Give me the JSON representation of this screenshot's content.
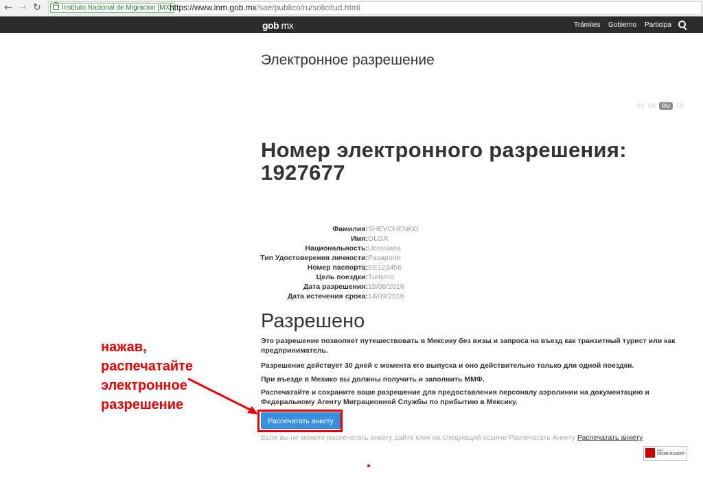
{
  "browser": {
    "ev_label": "Instituto Nacional de Migracion [MX]",
    "url_host": "https://www.inm.gob.mx",
    "url_path": "/sae/publico/ru/solicitud.html",
    "back_icon": "back-arrow-icon",
    "forward_icon": "forward-arrow-icon",
    "reload_icon": "reload-icon"
  },
  "header": {
    "brand_main": "gob",
    "brand_suffix": "mx",
    "nav": [
      "Trámites",
      "Gobierno",
      "Participa"
    ],
    "search_icon": "search-icon",
    "bg_color": "#2b2b2b"
  },
  "page": {
    "title": "Электронное разрешение",
    "languages": [
      "ES",
      "EN",
      "RU",
      "FR"
    ],
    "active_language": "RU",
    "permit_title": "Номер электронного разрешения:",
    "permit_number": "1927677"
  },
  "details": [
    {
      "label": "Фамилия:",
      "value": "SHEVCHENKO"
    },
    {
      "label": "Имя:",
      "value": "OLGA"
    },
    {
      "label": "Национальность:",
      "value": "Ucraniana"
    },
    {
      "label": "Тип Удостоверения личности:",
      "value": "Pasaporte"
    },
    {
      "label": "Номер паспорта:",
      "value": "EE123456"
    },
    {
      "label": "Цель поездки:",
      "value": "Turismo"
    },
    {
      "label": "Дата разрешения:",
      "value": "15/08/2016"
    },
    {
      "label": "Дата истечения срока:",
      "value": "14/09/2016"
    }
  ],
  "status": {
    "heading": "Разрешено",
    "paragraphs": [
      "Это разрешение позволяет путешествовать в Мексику без визы и запроса на въезд как транзитный турист или как предприниматель.",
      "Разрешение действует 30 дней с момента его выпуска и оно действительно только для одной поездки.",
      "При въезде в Мехико вы должны получить и заполнить ММФ.",
      "Распечатайте и сохраните ваше разрешение для предоставления персоналу аэролинии на документацию и Федеральному Агенту Миграционной Службы по прибытию в Мексику."
    ]
  },
  "print": {
    "button_label": "Распечатать анкету",
    "hint_text": "Если вы не можете распечатать анкету дайте клик на следующей ссылке Распечатать Анкету ",
    "hint_link": "Распечатать анкету",
    "highlight_color": "#ee0000"
  },
  "annotation": {
    "lines": [
      "нажав,",
      "распечатайте",
      "электронное",
      "разрешение"
    ],
    "color": "#ee0000"
  },
  "acrobat": {
    "line1": "Get",
    "line2": "ADOBE READER",
    "icon": "adobe-reader-icon"
  }
}
